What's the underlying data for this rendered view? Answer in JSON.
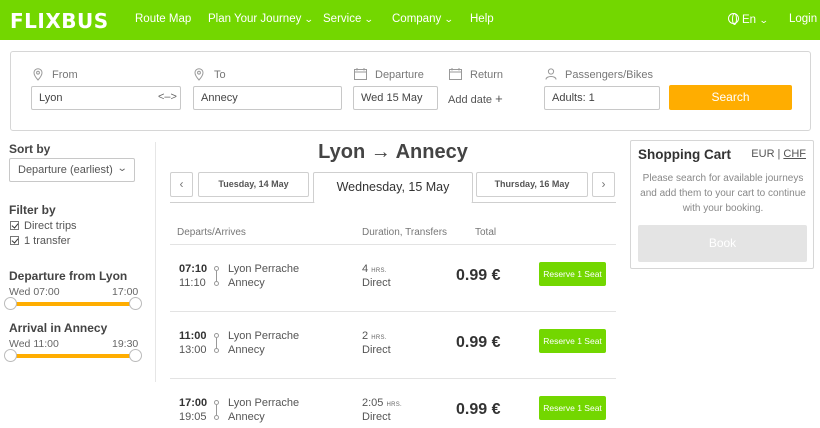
{
  "nav": {
    "logo": "FLIXBUS",
    "items": [
      "Route Map",
      "Plan Your Journey",
      "Service",
      "Company",
      "Help"
    ],
    "language": "En",
    "login": "Login"
  },
  "search": {
    "from_label": "From",
    "from_value": "Lyon",
    "to_label": "To",
    "to_value": "Annecy",
    "departure_label": "Departure",
    "departure_value": "Wed 15 May",
    "return_label": "Return",
    "return_value": "Add date",
    "passengers_label": "Passengers/Bikes",
    "passengers_value": "Adults: 1",
    "button": "Search"
  },
  "sidebar": {
    "sort_title": "Sort by",
    "sort_value": "Departure (earliest)",
    "filter_title": "Filter by",
    "filters": [
      "Direct trips",
      "1 transfer"
    ],
    "departure_title": "Departure from Lyon",
    "departure_min": "Wed 07:00",
    "departure_max": "17:00",
    "arrival_title": "Arrival in Annecy",
    "arrival_min": "Wed 11:00",
    "arrival_max": "19:30"
  },
  "main": {
    "route_title": "Lyon → Annecy",
    "prev_arrow": "‹",
    "next_arrow": "›",
    "dates": [
      "Tuesday, 14 May",
      "Wednesday, 15 May",
      "Thursday, 16 May"
    ],
    "columns": [
      "Departs/Arrives",
      "Duration, Transfers",
      "Total"
    ],
    "trips": [
      {
        "dep": "07:10",
        "arr": "11:10",
        "from": "Lyon Perrache",
        "to": "Annecy",
        "duration": "4",
        "duration_unit": "HRS.",
        "transfers": "Direct",
        "price": "0.99 €",
        "button": "Reserve 1 Seat"
      },
      {
        "dep": "11:00",
        "arr": "13:00",
        "from": "Lyon Perrache",
        "to": "Annecy",
        "duration": "2",
        "duration_unit": "HRS.",
        "transfers": "Direct",
        "price": "0.99 €",
        "button": "Reserve 1 Seat"
      },
      {
        "dep": "17:00",
        "arr": "19:05",
        "from": "Lyon Perrache",
        "to": "Annecy",
        "duration": "2:05",
        "duration_unit": "HRS.",
        "transfers": "Direct",
        "price": "0.99 €",
        "button": "Reserve 1 Seat"
      }
    ]
  },
  "cart": {
    "title": "Shopping Cart",
    "currency_1": "EUR",
    "currency_2": "CHF",
    "message": "Please search for available journeys and add them to your cart to continue with your booking.",
    "button": "Book"
  },
  "colors": {
    "brand": "#73d700",
    "accent": "#ffad00"
  }
}
